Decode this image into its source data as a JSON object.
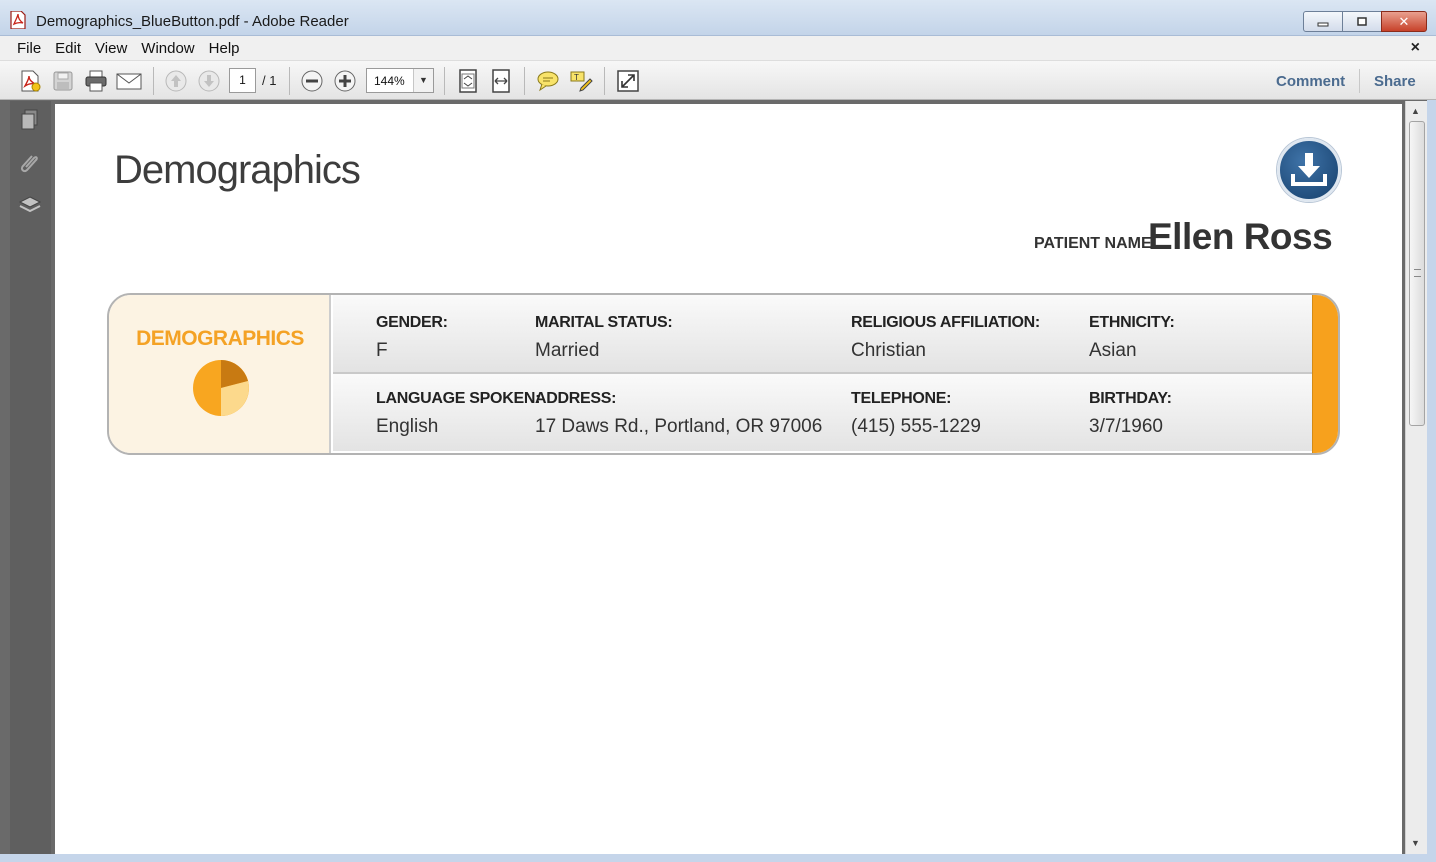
{
  "window": {
    "title": "Demographics_BlueButton.pdf - Adobe Reader",
    "minimize": "▁",
    "maximize": "▢",
    "close": "✕"
  },
  "menu": {
    "items": [
      "File",
      "Edit",
      "View",
      "Window",
      "Help"
    ],
    "doc_close": "×"
  },
  "toolbar": {
    "page_current": "1",
    "page_total": "/ 1",
    "zoom": "144%",
    "zoom_arrow": "▼",
    "comment": "Comment",
    "share": "Share",
    "icons": [
      "create-pdf-icon",
      "save-icon",
      "print-icon",
      "email-icon",
      "previous-page-icon",
      "next-page-icon",
      "zoom-out-icon",
      "zoom-in-icon",
      "fit-page-icon",
      "fit-width-icon",
      "sticky-note-icon",
      "highlight-icon",
      "full-screen-icon"
    ]
  },
  "navigation_panel": {
    "icons": [
      "pages-icon",
      "attachments-icon",
      "layers-icon"
    ]
  },
  "scrollbar": {
    "up": "▲",
    "down": "▼"
  },
  "document": {
    "title": "Demographics",
    "patient_label": "PATIENT NAME:",
    "patient_name": "Ellen Ross",
    "section_label": "DEMOGRAPHICS",
    "rows": [
      [
        {
          "label": "GENDER:",
          "value": "F"
        },
        {
          "label": "MARITAL STATUS:",
          "value": "Married"
        },
        {
          "label": "RELIGIOUS AFFILIATION:",
          "value": "Christian"
        },
        {
          "label": "ETHNICITY:",
          "value": "Asian"
        }
      ],
      [
        {
          "label": "LANGUAGE SPOKEN:",
          "value": "English"
        },
        {
          "label": "ADDRESS:",
          "value": "17 Daws Rd., Portland, OR 97006"
        },
        {
          "label": "TELEPHONE:",
          "value": "(415) 555-1229"
        },
        {
          "label": "BIRTHDAY:",
          "value": "3/7/1960"
        }
      ]
    ]
  },
  "colors": {
    "accent": "#f7a11d",
    "section_label": "#f4a225",
    "badge_blue": "#1f4e80",
    "link": "#4b6b8f"
  }
}
